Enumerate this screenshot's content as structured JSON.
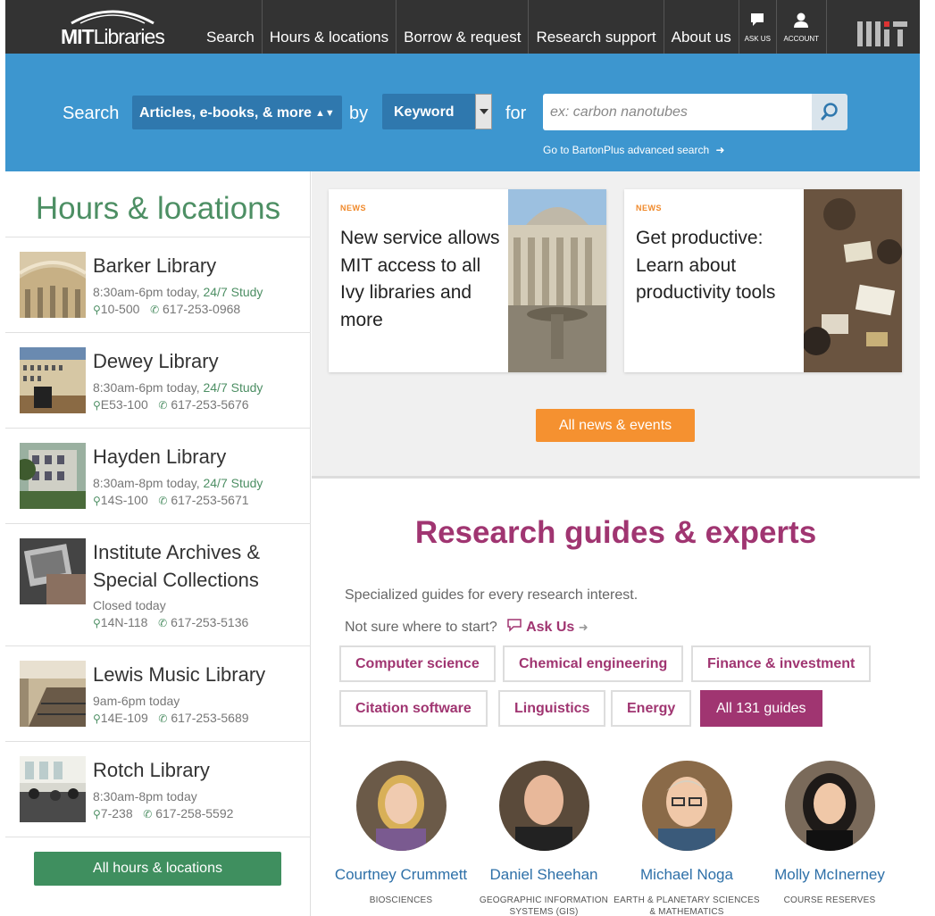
{
  "header": {
    "logo_text_bold": "MIT",
    "logo_text_rest": "Libraries",
    "nav": [
      {
        "label": "Search"
      },
      {
        "label": "Hours & locations"
      },
      {
        "label": "Borrow & request"
      },
      {
        "label": "Research support"
      },
      {
        "label": "About us"
      }
    ],
    "ask_us_label": "ASK US",
    "account_label": "ACCOUNT",
    "logo_icon": "mit-logo-icon"
  },
  "search": {
    "search_label": "Search",
    "scope_value": "Articles, e-books, & more",
    "by_label": "by",
    "field_value": "Keyword",
    "for_label": "for",
    "placeholder": "ex: carbon nanotubes",
    "advanced_link": "Go to BartonPlus advanced search",
    "accent": "#3d96cf"
  },
  "hours": {
    "title": "Hours & locations",
    "libraries": [
      {
        "name": "Barker Library",
        "hours": "8:30am-6pm today,",
        "study": "24/7 Study",
        "room": "10-500",
        "phone": "617-253-0968"
      },
      {
        "name": "Dewey Library",
        "hours": "8:30am-6pm today,",
        "study": "24/7 Study",
        "room": "E53-100",
        "phone": "617-253-5676"
      },
      {
        "name": "Hayden Library",
        "hours": "8:30am-8pm today,",
        "study": "24/7 Study",
        "room": "14S-100",
        "phone": "617-253-5671"
      },
      {
        "name": "Institute Archives & Special Collections",
        "hours": "Closed today",
        "study": "",
        "room": "14N-118",
        "phone": "617-253-5136"
      },
      {
        "name": "Lewis Music Library",
        "hours": "9am-6pm today",
        "study": "",
        "room": "14E-109",
        "phone": "617-253-5689"
      },
      {
        "name": "Rotch Library",
        "hours": "8:30am-8pm today",
        "study": "",
        "room": "7-238",
        "phone": "617-258-5592"
      }
    ],
    "all_button": "All hours & locations"
  },
  "news": {
    "cards": [
      {
        "tag": "NEWS",
        "headline": "New service allows MIT access to all Ivy libraries and more"
      },
      {
        "tag": "NEWS",
        "headline": "Get productive: Learn about productivity tools"
      }
    ],
    "all_button": "All news & events"
  },
  "guides": {
    "title": "Research guides & experts",
    "description": "Specialized guides for every research interest.",
    "not_sure": "Not sure where to start?",
    "ask_us": "Ask Us",
    "items": [
      {
        "label": "Computer science"
      },
      {
        "label": "Chemical engineering"
      },
      {
        "label": "Finance & investment"
      },
      {
        "label": "Citation software"
      },
      {
        "label": "Linguistics"
      },
      {
        "label": "Energy"
      },
      {
        "label": "All 131 guides"
      }
    ]
  },
  "experts": [
    {
      "name": "Courtney Crummett",
      "dept": "BIOSCIENCES"
    },
    {
      "name": "Daniel Sheehan",
      "dept": "GEOGRAPHIC INFORMATION SYSTEMS (GIS)"
    },
    {
      "name": "Michael Noga",
      "dept": "EARTH & PLANETARY SCIENCES & MATHEMATICS"
    },
    {
      "name": "Molly McInerney",
      "dept": "COURSE RESERVES"
    }
  ]
}
